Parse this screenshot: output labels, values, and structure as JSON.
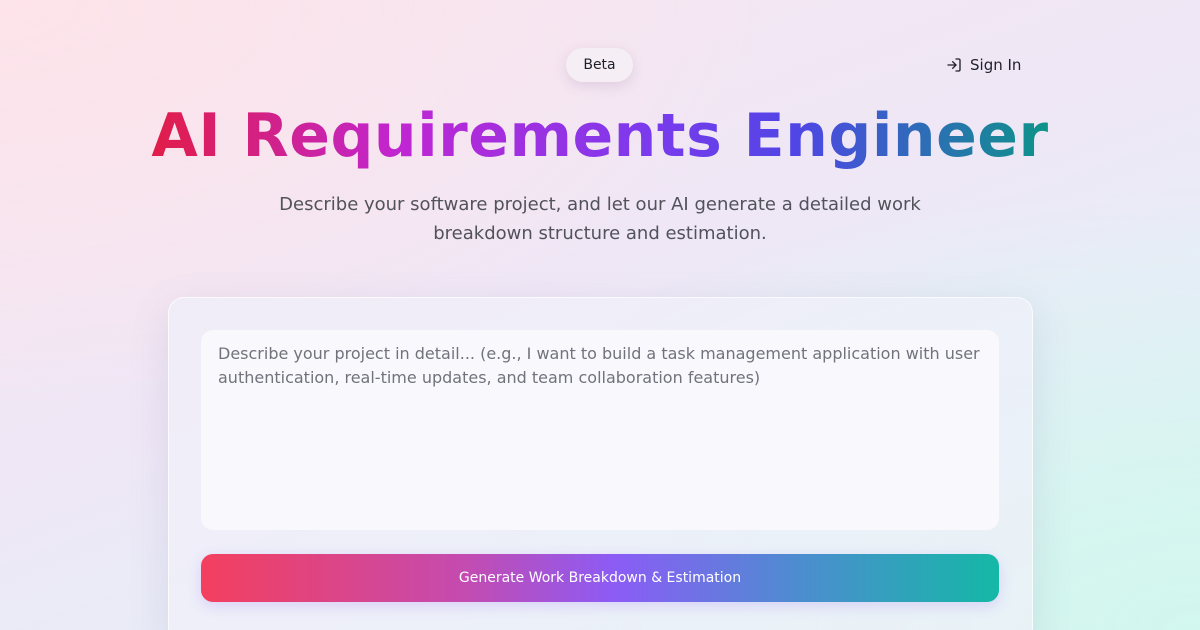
{
  "header": {
    "badge": "Beta",
    "sign_in": {
      "label": "Sign In",
      "icon": "sign-in-icon"
    }
  },
  "hero": {
    "title": "AI Requirements Engineer",
    "subtitle": "Describe your software project, and let our AI generate a detailed work breakdown structure and estimation."
  },
  "form": {
    "input": {
      "value": "",
      "placeholder": "Describe your project in detail... (e.g., I want to build a task management application with user authentication, real-time updates, and team collaboration features)"
    },
    "submit_label": "Generate Work Breakdown & Estimation"
  },
  "colors": {
    "title_gradient": [
      "#e11d48",
      "#c026d3",
      "#7c3aed",
      "#4f46e5",
      "#0d9488"
    ],
    "button_gradient": [
      "#f43f5e",
      "#8b5cf6",
      "#14b8a6"
    ],
    "text_primary": "#1f1f2b",
    "text_secondary": "#52525b"
  }
}
